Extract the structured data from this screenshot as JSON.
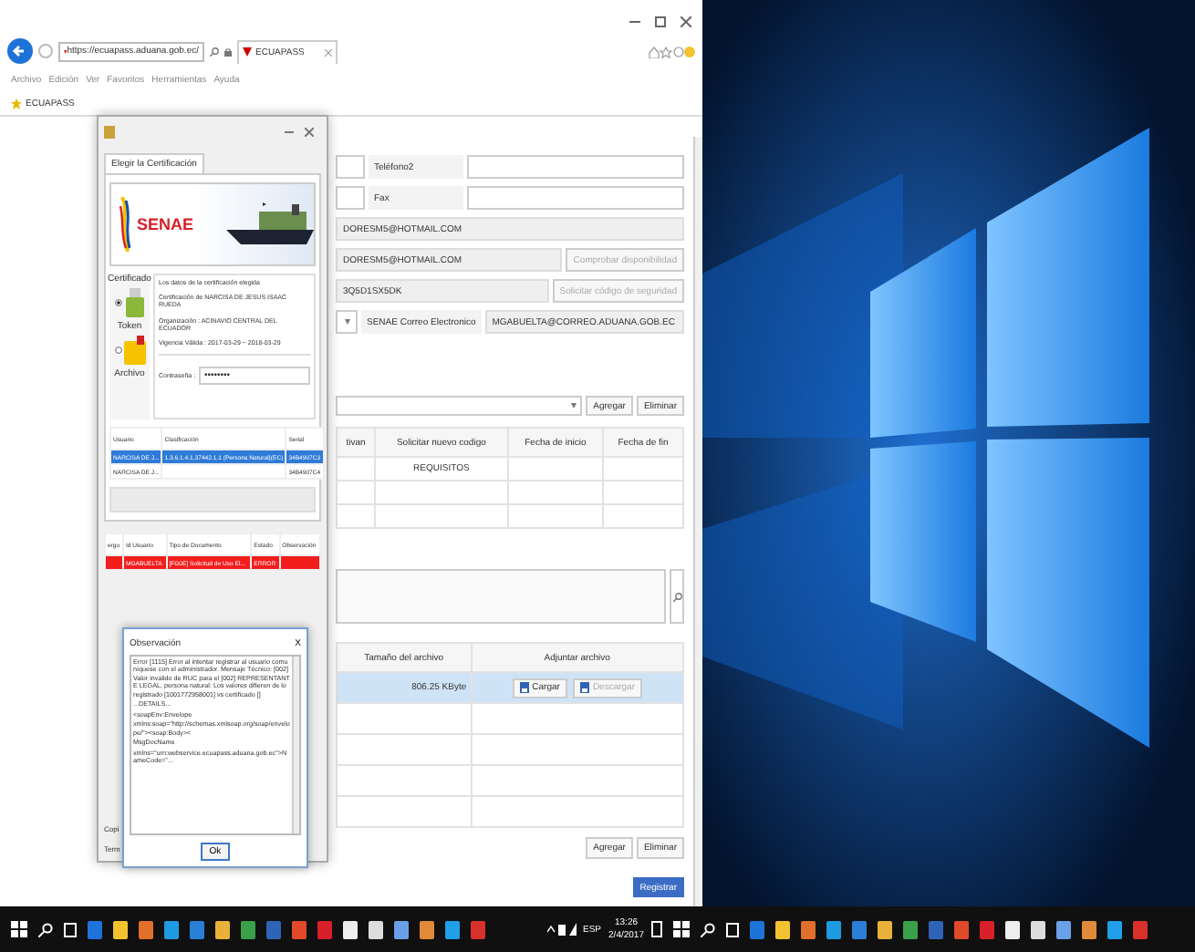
{
  "browser": {
    "url": "https://ecuapass.aduana.gob.ec/",
    "tab_title": "ECUAPASS",
    "menu": [
      "Archivo",
      "Edición",
      "Ver",
      "Favoritos",
      "Herramientas",
      "Ayuda"
    ],
    "favorites": [
      "ECUAPASS"
    ]
  },
  "form": {
    "rows": [
      {
        "kind": "labeled",
        "label": "Teléfono2"
      },
      {
        "kind": "labeled",
        "label": "Fax"
      },
      {
        "kind": "value",
        "value": "DORESM5@HOTMAIL.COM"
      },
      {
        "kind": "value_button",
        "value": "DORESM5@HOTMAIL.COM",
        "button": "Comprobar disponibilidad",
        "disabled": true
      },
      {
        "kind": "value_button",
        "value": "3Q5D1SX5DK",
        "button": "Solicitar código de seguridad",
        "disabled": true
      },
      {
        "kind": "select_value",
        "label": "SENAE Correo Electronico",
        "value": "MGABUELTA@CORREO.ADUANA.GOB.EC"
      }
    ],
    "add_button": "Agregar",
    "remove_button": "Eliminar",
    "codes_table": {
      "columns": [
        "tivan",
        "Solicitar nuevo codigo",
        "Fecha de inicio",
        "Fecha de fin"
      ],
      "rows": [
        [
          "",
          "REQUISITOS",
          "",
          ""
        ],
        [
          "",
          "",
          "",
          ""
        ],
        [
          "",
          "",
          "",
          ""
        ]
      ]
    },
    "files_table": {
      "columns": [
        "Tamaño del archivo",
        "Adjuntar archivo"
      ],
      "rows": [
        {
          "size": "806.25 KByte",
          "upload": "Cargar",
          "download": "Descargar",
          "download_disabled": true,
          "selected": true
        }
      ]
    },
    "bottom_add_button": "Agregar",
    "bottom_remove_button": "Eliminar",
    "submit_button": "Registrar"
  },
  "cert_dialog": {
    "tab": "Elegir la Certificación",
    "brand": "SENAE",
    "group_label": "Certificado",
    "details_title": "Los datos de la certificación elegida",
    "details": [
      "Certificación de NARCISA DE JESUS ISAAC RUEDA",
      "Organización : ACINAVIO CENTRAL DEL ECUADOR",
      "Vigencia Válida : 2017-03-29 ~ 2018-03-29"
    ],
    "sources": [
      {
        "label": "Token",
        "selected": true
      },
      {
        "label": "Archivo",
        "selected": false
      }
    ],
    "password_label": "Contraseña :",
    "password": "••••••••",
    "table": {
      "columns": [
        "Usuario",
        "Clasificación",
        "Serial"
      ],
      "rows": [
        {
          "cells": [
            "NARCISA DE J...",
            "1.3.6.1.4.1.37442.1.1 (Persona Natural)(EC)",
            "34B4907C3"
          ],
          "selected": true
        },
        {
          "cells": [
            "NARCISA DE J...",
            "",
            "34B4907C4"
          ],
          "selected": false
        }
      ]
    },
    "result_table": {
      "columns": [
        "ergo",
        "Id Usuario",
        "Tipo de Documento",
        "Estado",
        "Observación"
      ],
      "rows": [
        {
          "cells": [
            "",
            "MGABUELTA",
            "[FG0E] Solicitud de Uso El...",
            "ERROR"
          ],
          "error": true
        }
      ]
    },
    "footer_labels": [
      "Copi",
      "Term"
    ]
  },
  "obs_dialog": {
    "title": "Observación",
    "close": "X",
    "message": "Error [1115] Error al intentar registrar al usuario comuníquese con el administrador. Mensaje Técnico: [002] Valor inválido de RUC para el [002] REPRESENTANTE LEGAL, persona natural: Los valores difieren de lo registrado [1001772958001] vs certificado []",
    "details": [
      "...DETAILS...",
      "<soapEnv:Envelope",
      "xmlns:soap=\"http://schemas.xmlsoap.org/soap/envelope/\"><soap:Body><",
      "MsgDocName",
      "xmlns=\"urn:webservice.ecuapass.aduana.gob.ec\">NameCode=\"..."
    ],
    "ok": "Ok"
  },
  "taskbar": {
    "language": "ESP",
    "time": "13:26",
    "date": "2/4/2017"
  }
}
